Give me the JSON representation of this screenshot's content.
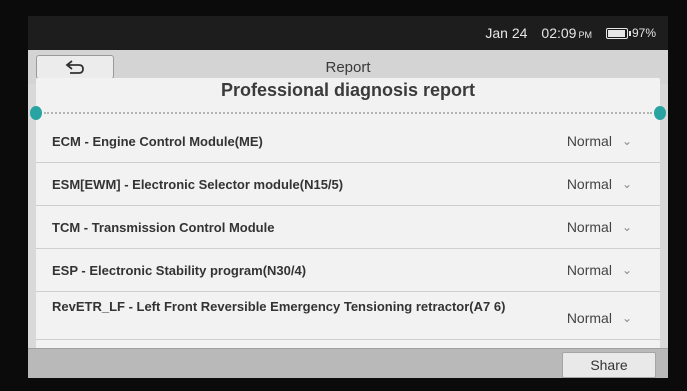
{
  "status_bar": {
    "date": "Jan 24",
    "time": "02:09",
    "ampm": "PM",
    "battery": "97%",
    "battery_level": 0.97
  },
  "header": {
    "title": "Report"
  },
  "report": {
    "title": "Professional diagnosis report",
    "rows": [
      {
        "label": "ECM - Engine Control Module(ME)",
        "status": "Normal"
      },
      {
        "label": "ESM[EWM] - Electronic Selector module(N15/5)",
        "status": "Normal"
      },
      {
        "label": "TCM - Transmission Control Module",
        "status": "Normal"
      },
      {
        "label": "ESP - Electronic Stability program(N30/4)",
        "status": "Normal"
      },
      {
        "label": "RevETR_LF - Left Front Reversible Emergency Tensioning retractor(A7 6)",
        "status": "Normal"
      }
    ]
  },
  "bottom_bar": {
    "share_label": "Share"
  },
  "colors": {
    "accent": "#2aa3a3"
  }
}
